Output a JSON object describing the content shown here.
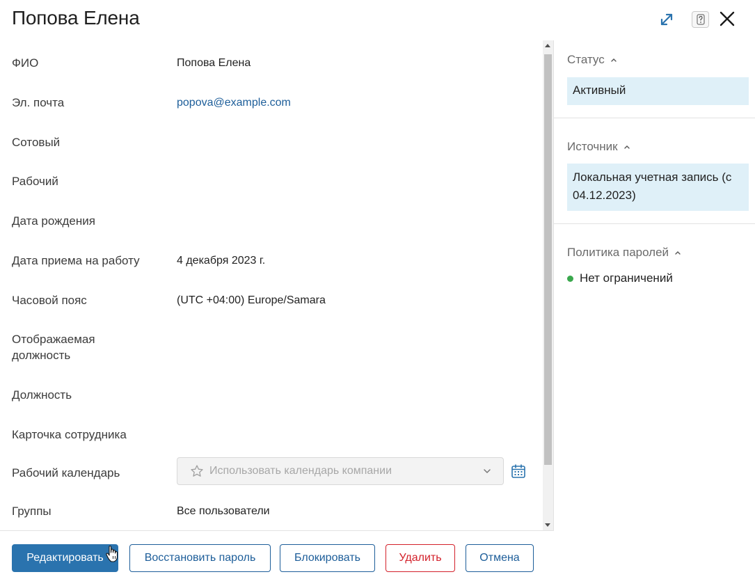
{
  "window": {
    "title": "Попова Елена"
  },
  "fields": [
    {
      "label": "ФИО",
      "value": "Попова Елена"
    },
    {
      "label": "Эл. почта",
      "value": "popova@example.com"
    },
    {
      "label": "Сотовый",
      "value": ""
    },
    {
      "label": "Рабочий",
      "value": ""
    },
    {
      "label": "Дата рождения",
      "value": ""
    },
    {
      "label": "Дата приема на работу",
      "value": "4 декабря 2023 г."
    },
    {
      "label": "Часовой пояс",
      "value": "(UTC +04:00) Europe/Samara"
    },
    {
      "label": "Отображаемая должность",
      "value": ""
    },
    {
      "label": "Должность",
      "value": ""
    },
    {
      "label": "Карточка сотрудника",
      "value": ""
    },
    {
      "label": "Рабочий календарь",
      "value": ""
    },
    {
      "label": "Группы",
      "value": "Все пользователи"
    }
  ],
  "calendar_select": {
    "placeholder": "Использовать календарь компании"
  },
  "sidebar": {
    "status": {
      "title": "Статус",
      "value": "Активный"
    },
    "source": {
      "title": "Источник",
      "value": "Локальная учетная запись (с 04.12.2023)"
    },
    "password_policy": {
      "title": "Политика паролей",
      "value": "Нет ограничений",
      "indicator_color": "#3aa84d"
    }
  },
  "buttons": {
    "edit": "Редактировать",
    "reset_password": "Восстановить пароль",
    "block": "Блокировать",
    "delete": "Удалить",
    "cancel": "Отмена"
  },
  "colors": {
    "primary": "#2a73ae",
    "link": "#1c5d99",
    "danger": "#d3202a",
    "highlight_bg": "#dff0f8"
  },
  "icons": [
    "expand-icon",
    "help-icon",
    "close-icon",
    "star-icon",
    "chevron-down-icon",
    "calendar-icon",
    "caret-up-icon",
    "hand-cursor-icon"
  ]
}
